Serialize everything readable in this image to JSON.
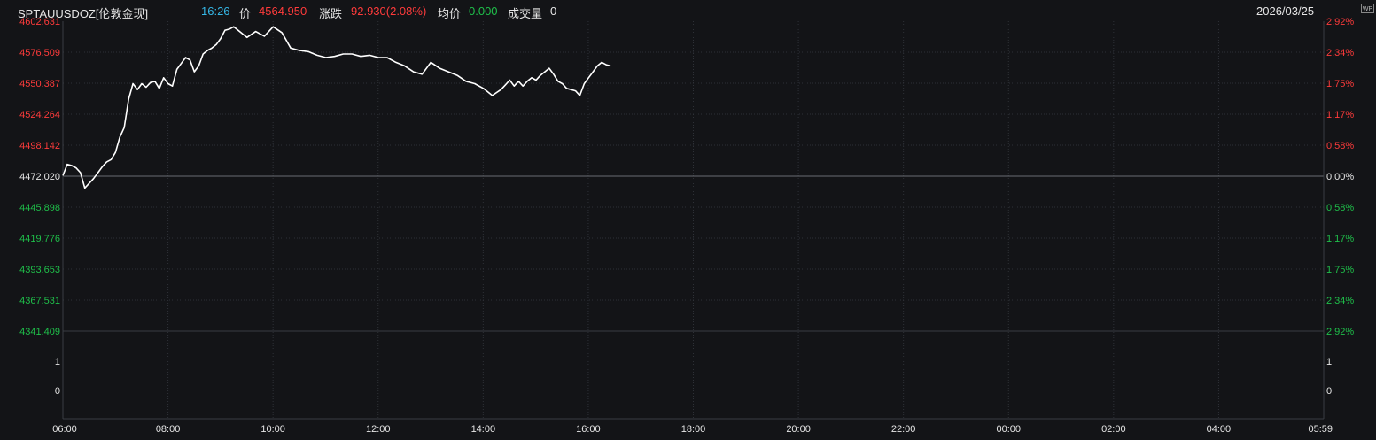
{
  "header": {
    "symbol": "SPTAUUSDOZ[伦敦金现]",
    "time": "16:26",
    "price_label": "价",
    "price": "4564.950",
    "change_label": "涨跌",
    "change": "92.930(2.08%)",
    "avg_label": "均价",
    "avg": "0.000",
    "volume_label": "成交量",
    "volume": "0",
    "date": "2026/03/25",
    "badge": "WP"
  },
  "colors": {
    "background": "#131417",
    "grid": "#2e3137",
    "line": "#ffffff",
    "up": "#ff3b3b",
    "down": "#1fbf4a",
    "time": "#35b7e6",
    "text": "#e6e6e6"
  },
  "chart_data": {
    "type": "line",
    "title": "",
    "xlabel": "",
    "ylabel": "",
    "base_price": 4472.02,
    "ylim": [
      4341.409,
      4602.631
    ],
    "grid": true,
    "y_ticks_left": [
      "4602.631",
      "4576.509",
      "4550.387",
      "4524.264",
      "4498.142",
      "4472.020",
      "4445.898",
      "4419.776",
      "4393.653",
      "4367.531",
      "4341.409"
    ],
    "y_ticks_right": [
      "2.92%",
      "2.34%",
      "1.75%",
      "1.17%",
      "0.58%",
      "0.00%",
      "0.58%",
      "1.17%",
      "1.75%",
      "2.34%",
      "2.92%"
    ],
    "volume_ticks_left": [
      "1",
      "0"
    ],
    "volume_ticks_right": [
      "1",
      "0"
    ],
    "x_ticks": [
      "06:00",
      "08:00",
      "10:00",
      "12:00",
      "14:00",
      "16:00",
      "18:00",
      "20:00",
      "22:00",
      "00:00",
      "02:00",
      "04:00",
      "05:59"
    ],
    "session_minutes": 1439,
    "series": [
      {
        "x_minutes": [
          0,
          5,
          10,
          15,
          20,
          25,
          30,
          35,
          40,
          45,
          50,
          55,
          60,
          65,
          70,
          75,
          80,
          85,
          90,
          95,
          100,
          105,
          110,
          115,
          120,
          125,
          130,
          135,
          140,
          145,
          150,
          155,
          160,
          165,
          170,
          175,
          180,
          185,
          190,
          195,
          200,
          210,
          220,
          230,
          240,
          250,
          260,
          270,
          280,
          290,
          300,
          310,
          320,
          330,
          340,
          350,
          360,
          370,
          380,
          390,
          400,
          410,
          420,
          430,
          440,
          450,
          460,
          470,
          480,
          490,
          500,
          505,
          510,
          515,
          520,
          525,
          530,
          535,
          540,
          545,
          550,
          555,
          560,
          565,
          570,
          575,
          580,
          585,
          590,
          595,
          600,
          605,
          610,
          615,
          620,
          625
        ],
        "values": [
          4472.5,
          4482,
          4481,
          4479,
          4475,
          4462,
          4466,
          4470,
          4475,
          4480,
          4484,
          4486,
          4492,
          4505,
          4513,
          4537,
          4550,
          4545,
          4550,
          4547,
          4551,
          4552,
          4546,
          4555,
          4550,
          4548,
          4562,
          4567,
          4572,
          4570,
          4560,
          4565,
          4575,
          4578,
          4580,
          4583,
          4588,
          4595,
          4596,
          4598,
          4595,
          4589,
          4594,
          4590,
          4598,
          4593,
          4580,
          4578,
          4577,
          4574,
          4572,
          4573,
          4575,
          4575,
          4573,
          4574,
          4572,
          4572,
          4568,
          4565,
          4560,
          4558,
          4568,
          4563,
          4560,
          4557,
          4552,
          4550,
          4546,
          4540,
          4545,
          4549,
          4553,
          4548,
          4552,
          4548,
          4552,
          4555,
          4553,
          4557,
          4560,
          4563,
          4558,
          4552,
          4550,
          4546,
          4545,
          4544,
          4540,
          4550,
          4555,
          4560,
          4565,
          4568,
          4566,
          4565
        ]
      }
    ]
  }
}
